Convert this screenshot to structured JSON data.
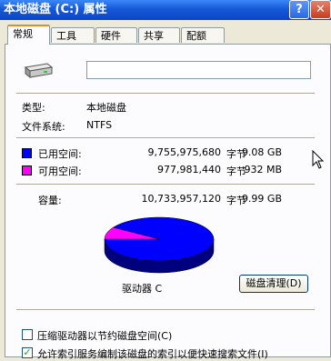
{
  "window": {
    "title": "本地磁盘 (C:) 属性",
    "help_label": "?",
    "close_label": "✕"
  },
  "tabs": [
    {
      "label": "常规",
      "active": true
    },
    {
      "label": "工具",
      "active": false
    },
    {
      "label": "硬件",
      "active": false
    },
    {
      "label": "共享",
      "active": false
    },
    {
      "label": "配额",
      "active": false
    }
  ],
  "general": {
    "volume_name": "",
    "type_label": "类型:",
    "type_value": "本地磁盘",
    "fs_label": "文件系统:",
    "fs_value": "NTFS",
    "used": {
      "label": "已用空间:",
      "bytes": "9,755,975,680",
      "unit": "字节",
      "size": "9.08 GB",
      "color": "#0000ff"
    },
    "free": {
      "label": "可用空间:",
      "bytes": "977,981,440",
      "unit": "字节",
      "size": "932 MB",
      "color": "#ff00ff"
    },
    "capacity": {
      "label": "容量:",
      "bytes": "10,733,957,120",
      "unit": "字节",
      "size": "9.99 GB"
    },
    "drive_label": "驱动器 C",
    "cleanup_button": "磁盘清理(D)",
    "used_fraction": 0.909
  },
  "options": {
    "compress_label": "压缩驱动器以节约磁盘空间(C)",
    "compress_checked": false,
    "index_label": "允许索引服务编制该磁盘的索引以便快速搜索文件(I)",
    "index_checked": true
  },
  "icons": {
    "drive": "hard-drive-icon",
    "cursor": "mouse-cursor-icon"
  }
}
